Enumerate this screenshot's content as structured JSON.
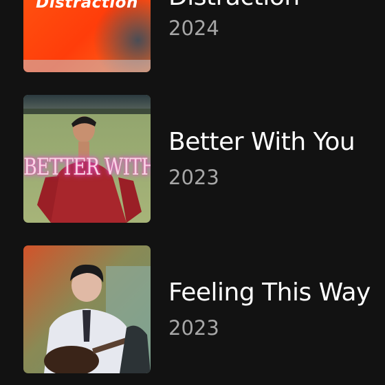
{
  "releases": [
    {
      "title": "Distraction",
      "year": "2024",
      "cover_text": "Distraction",
      "cover_icon": "album-cover-distraction"
    },
    {
      "title": "Better With You",
      "year": "2023",
      "cover_text": "BETTER WITH YOU",
      "cover_icon": "album-cover-better-with-you"
    },
    {
      "title": "Feeling This Way",
      "year": "2023",
      "cover_icon": "album-cover-feeling-this-way"
    }
  ],
  "colors": {
    "background": "#121212",
    "title": "#ffffff",
    "year": "#a7a7a7"
  }
}
